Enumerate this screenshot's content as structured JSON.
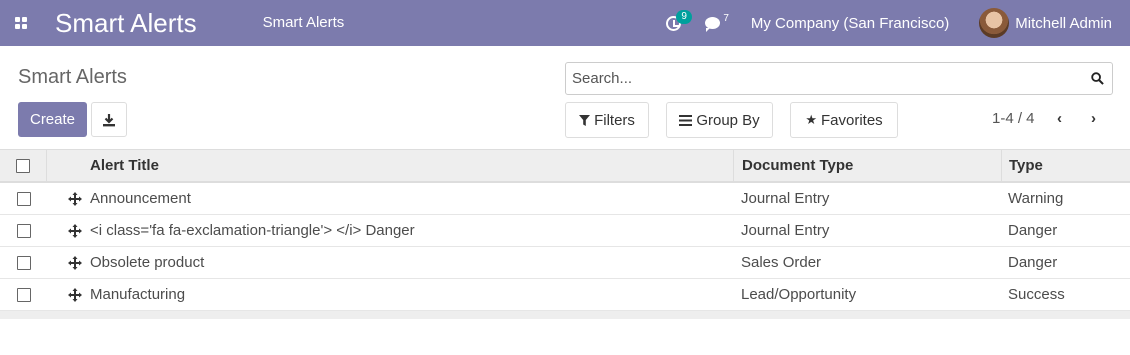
{
  "navbar": {
    "app_title": "Smart Alerts",
    "menu_item": "Smart Alerts",
    "activity_count": "9",
    "message_count": "7",
    "company": "My Company (San Francisco)",
    "user_name": "Mitchell Admin",
    "background_color": "#7c7bad",
    "activity_badge_color": "#00a09d"
  },
  "control_panel": {
    "title": "Smart Alerts",
    "create_label": "Create",
    "export_icon": "download-icon",
    "search_placeholder": "Search...",
    "filters_label": "Filters",
    "groupby_label": "Group By",
    "favorites_label": "Favorites",
    "pager_value": "1-4 / 4"
  },
  "table": {
    "headers": {
      "title": "Alert Title",
      "document_type": "Document Type",
      "type": "Type"
    },
    "rows": [
      {
        "title": "Announcement",
        "document_type": "Journal Entry",
        "type": "Warning"
      },
      {
        "title": "<i class='fa fa-exclamation-triangle'> </i> Danger",
        "document_type": "Journal Entry",
        "type": "Danger"
      },
      {
        "title": "Obsolete product",
        "document_type": "Sales Order",
        "type": "Danger"
      },
      {
        "title": "Manufacturing",
        "document_type": "Lead/Opportunity",
        "type": "Success"
      }
    ]
  }
}
